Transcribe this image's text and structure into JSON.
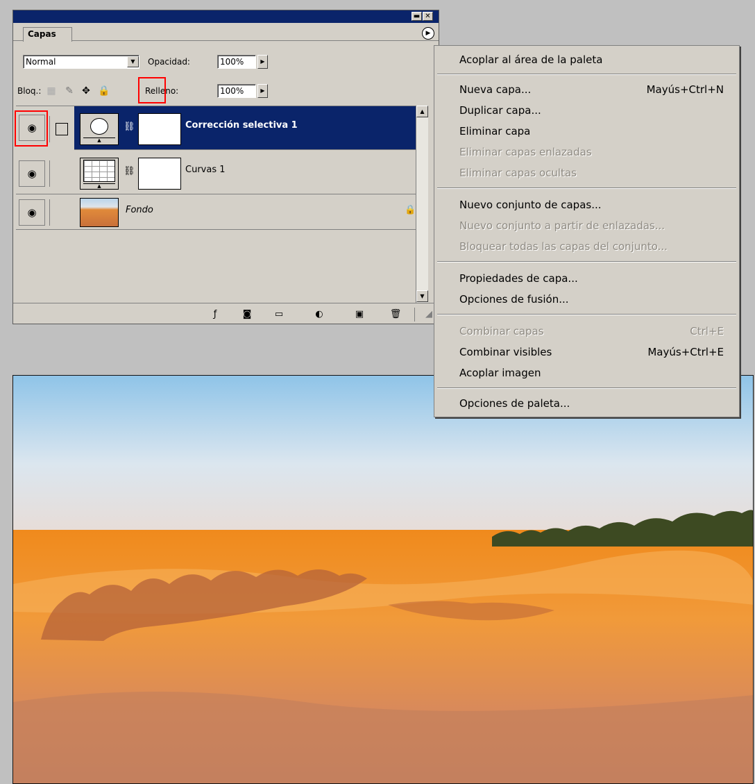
{
  "colors": {
    "selection": "#0a246a",
    "panel": "#d4d0c8",
    "highlight_box": "#ff0000",
    "disabled_text": "#8e8a82"
  },
  "palette": {
    "tab_label": "Capas",
    "blend_mode": "Normal",
    "opacity_label": "Opacidad:",
    "opacity_value": "100%",
    "lock_label": "Bloq.:",
    "fill_label": "Relleno:",
    "fill_value": "100%",
    "layers": [
      {
        "name": "Corrección selectiva 1",
        "selected": true
      },
      {
        "name": "Curvas 1",
        "selected": false
      },
      {
        "name": "Fondo",
        "selected": false,
        "locked": true
      }
    ]
  },
  "menu": {
    "items": [
      {
        "label": "Acoplar al área de la paleta",
        "shortcut": "",
        "disabled": false
      },
      {
        "label": "Nueva capa...",
        "shortcut": "Mayús+Ctrl+N",
        "disabled": false
      },
      {
        "label": "Duplicar capa...",
        "shortcut": "",
        "disabled": false
      },
      {
        "label": "Eliminar capa",
        "shortcut": "",
        "disabled": false
      },
      {
        "label": "Eliminar capas enlazadas",
        "shortcut": "",
        "disabled": true
      },
      {
        "label": "Eliminar capas ocultas",
        "shortcut": "",
        "disabled": true
      },
      {
        "label": "Nuevo conjunto de capas...",
        "shortcut": "",
        "disabled": false
      },
      {
        "label": "Nuevo conjunto a partir de enlazadas...",
        "shortcut": "",
        "disabled": true
      },
      {
        "label": "Bloquear todas las capas del conjunto...",
        "shortcut": "",
        "disabled": true
      },
      {
        "label": "Propiedades de capa...",
        "shortcut": "",
        "disabled": false
      },
      {
        "label": "Opciones de fusión...",
        "shortcut": "",
        "disabled": false
      },
      {
        "label": "Combinar capas",
        "shortcut": "Ctrl+E",
        "disabled": true
      },
      {
        "label": "Combinar visibles",
        "shortcut": "Mayús+Ctrl+E",
        "disabled": false
      },
      {
        "label": "Acoplar imagen",
        "shortcut": "",
        "disabled": false
      },
      {
        "label": "Opciones de paleta...",
        "shortcut": "",
        "disabled": false
      }
    ]
  }
}
